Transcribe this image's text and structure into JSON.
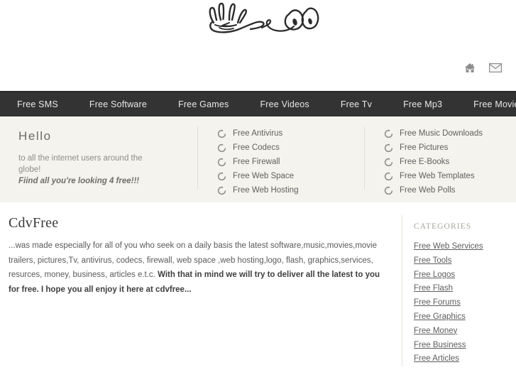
{
  "site": {
    "logo_alt": "hand-and-eyes-sketch-logo"
  },
  "header": {
    "icons": [
      {
        "name": "home-icon",
        "label": "Home"
      },
      {
        "name": "mail-icon",
        "label": "Contact"
      }
    ]
  },
  "nav": {
    "items": [
      {
        "label": "Free SMS"
      },
      {
        "label": "Free Software"
      },
      {
        "label": "Free Games"
      },
      {
        "label": "Free Videos"
      },
      {
        "label": "Free Tv"
      },
      {
        "label": "Free Mp3"
      },
      {
        "label": "Free Movie"
      }
    ]
  },
  "intro": {
    "hello_title": "Hello",
    "hello_line1": "to all the internet users around the",
    "hello_line2": "globe!",
    "hello_tagline": "Fiind all you're looking 4 free!!!",
    "links_col1": [
      {
        "label": "Free Antivirus"
      },
      {
        "label": "Free Codecs"
      },
      {
        "label": "Free Firewall"
      },
      {
        "label": "Free Web Space"
      },
      {
        "label": "Free Web Hosting"
      }
    ],
    "links_col2": [
      {
        "label": "Free Music Downloads"
      },
      {
        "label": "Free Pictures"
      },
      {
        "label": "Free E-Books"
      },
      {
        "label": "Free Web Templates"
      },
      {
        "label": "Free Web Polls"
      }
    ]
  },
  "article": {
    "title": "CdvFree",
    "text_normal_1": "...was made especially for all of you who seek on a daily basis the latest software,music,movies,movie trailers, pictures,Tv, antivirus, codecs, firewall, web space ,web hosting,logo, flash, graphics,services, resurces, money, business, articles e.t.c. ",
    "text_bold": "With that in mind we will try to deliver all the latest to you for free. I hope you all enjoy it here at cdvfree..."
  },
  "sidebar": {
    "title": "CATEGORIES",
    "items": [
      {
        "label": "Free Web Services"
      },
      {
        "label": "Free Tools"
      },
      {
        "label": "Free Logos"
      },
      {
        "label": "Free Flash"
      },
      {
        "label": "Free Forums"
      },
      {
        "label": "Free Graphics"
      },
      {
        "label": "Free Money"
      },
      {
        "label": "Free Business"
      },
      {
        "label": "Free Articles"
      }
    ]
  },
  "colors": {
    "nav_background": "#333333",
    "intro_background": "#f4f3ed",
    "page_background": "#ffffff",
    "text": "#5a5a5a",
    "muted_text": "#a8a69c"
  }
}
